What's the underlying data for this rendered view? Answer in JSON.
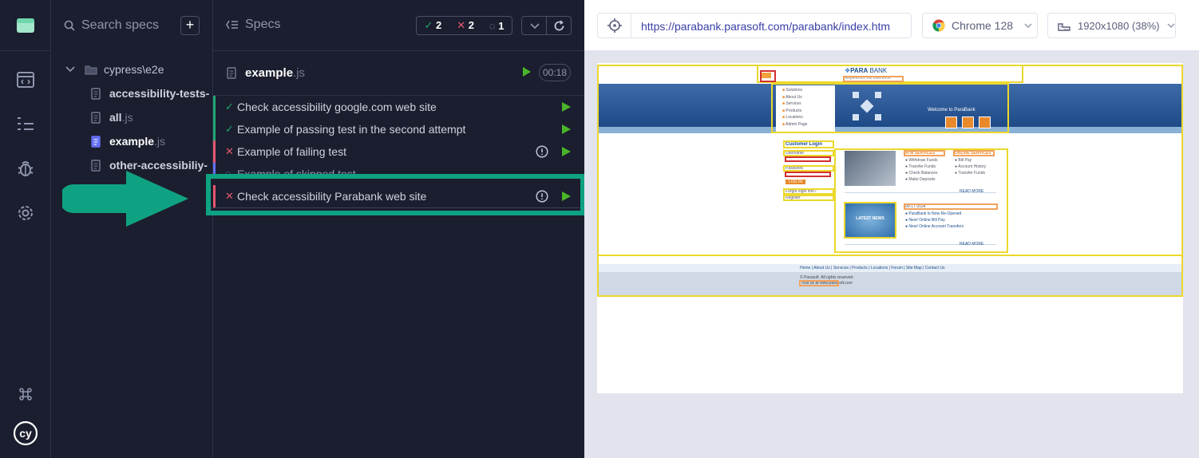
{
  "search": {
    "placeholder": "Search specs"
  },
  "tree": {
    "folder": "cypress\\e2e",
    "files": [
      {
        "name": "accessibility-tests-",
        "ext": ""
      },
      {
        "name": "all",
        "ext": ".js"
      },
      {
        "name": "example",
        "ext": ".js"
      },
      {
        "name": "other-accessibiliy-",
        "ext": ""
      }
    ]
  },
  "runner": {
    "specs_label": "Specs",
    "passed": "2",
    "failed": "2",
    "pending": "1",
    "file": {
      "name": "example",
      "ext": ".js",
      "duration": "00:18"
    },
    "tests": [
      {
        "title": "Check accessibility google.com web site",
        "state": "passed"
      },
      {
        "title": "Example of passing test in the second attempt",
        "state": "passed"
      },
      {
        "title": "Example of failing test",
        "state": "failed"
      },
      {
        "title": "Example of skipped test",
        "state": "pending"
      },
      {
        "title": "Check accessibility Parabank web site",
        "state": "failed"
      }
    ]
  },
  "preview": {
    "url": "https://parabank.parasoft.com/parabank/index.htm",
    "browser": "Chrome 128",
    "viewport": "1920x1080 (38%)"
  },
  "site": {
    "brand_a": "PARA",
    "brand_b": "BANK",
    "tagline": "Experience the difference",
    "menu": [
      "Solutions",
      "About Us",
      "Services",
      "Products",
      "Locations",
      "Admin Page"
    ],
    "welcome": "Welcome to ParaBank",
    "login_title": "Customer Login",
    "username": "Username",
    "password": "Password",
    "login_button": "LOG IN",
    "forgot": "Forgot login info?",
    "register": "Register",
    "atm_title": "ATM SERVICES",
    "atm_items": [
      "Withdraw Funds",
      "Transfer Funds",
      "Check Balances",
      "Make Deposits"
    ],
    "online_title": "ONLINE SERVICES",
    "online_items": [
      "Bill Pay",
      "Account History",
      "Transfer Funds"
    ],
    "read_more": "READ MORE",
    "news_badge": "LATEST NEWS",
    "news_date": "09-17-2024",
    "news_items": [
      "ParaBank Is Now Re-Opened",
      "New! Online Bill Pay",
      "New! Online Account Transfers"
    ],
    "footer_links": [
      "Home",
      "About Us",
      "Services",
      "Products",
      "Locations",
      "Forum",
      "Site Map",
      "Contact Us"
    ],
    "copyright": "© Parasoft. All rights reserved.",
    "visit": "Visit us at www.parasoft.com"
  },
  "colors": {
    "accent": "#6470f3",
    "passed": "#1fa971",
    "failed": "#e45770",
    "play": "#4ab52a",
    "highlight": "#0fa282"
  }
}
